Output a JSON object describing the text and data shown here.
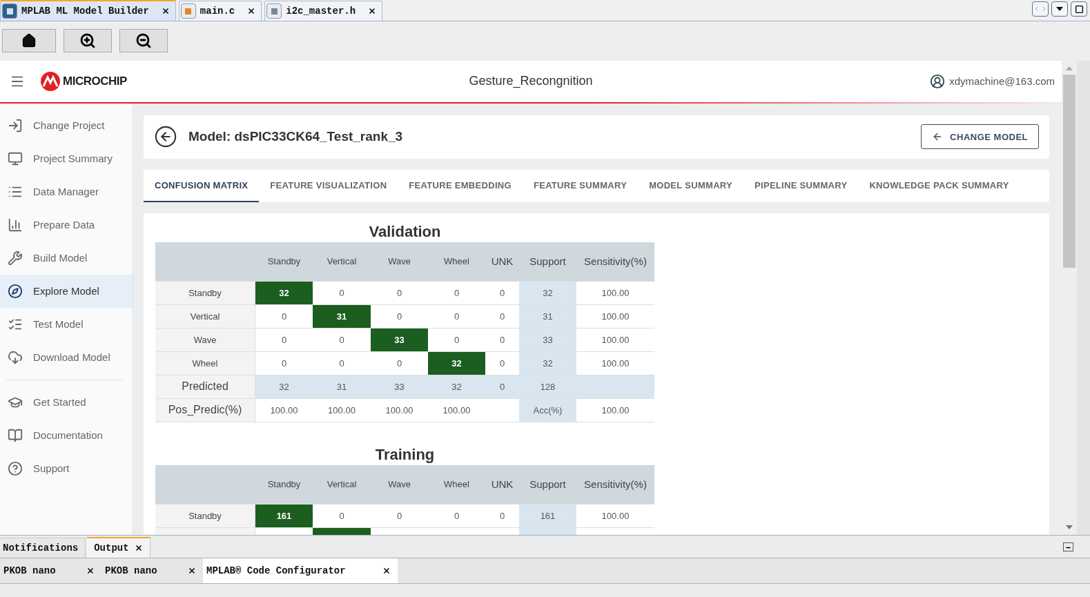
{
  "editor_tabs": [
    {
      "label": "MPLAB ML Model Builder",
      "kind": "app",
      "selected": true
    },
    {
      "label": "main.c",
      "kind": "c",
      "selected": false
    },
    {
      "label": "i2c_master.h",
      "kind": "h",
      "selected": false
    }
  ],
  "app_header": {
    "logo": "MICROCHIP",
    "project": "Gesture_Recongnition",
    "user": "xdymachine@163.com"
  },
  "sidebar": {
    "groups": [
      {
        "items": [
          {
            "label": "Change Project",
            "selected": false
          },
          {
            "label": "Project Summary",
            "selected": false
          },
          {
            "label": "Data Manager",
            "selected": false
          },
          {
            "label": "Prepare Data",
            "selected": false
          },
          {
            "label": "Build Model",
            "selected": false
          },
          {
            "label": "Explore Model",
            "selected": true
          },
          {
            "label": "Test Model",
            "selected": false
          },
          {
            "label": "Download Model",
            "selected": false
          }
        ]
      },
      {
        "items": [
          {
            "label": "Get Started",
            "selected": false
          },
          {
            "label": "Documentation",
            "selected": false
          },
          {
            "label": "Support",
            "selected": false
          }
        ]
      }
    ]
  },
  "model": {
    "title": "Model: dsPIC33CK64_Test_rank_3",
    "change_button": "CHANGE MODEL"
  },
  "tabs": [
    {
      "label": "CONFUSION MATRIX",
      "selected": true
    },
    {
      "label": "FEATURE VISUALIZATION",
      "selected": false
    },
    {
      "label": "FEATURE EMBEDDING",
      "selected": false
    },
    {
      "label": "FEATURE SUMMARY",
      "selected": false
    },
    {
      "label": "MODEL SUMMARY",
      "selected": false
    },
    {
      "label": "PIPELINE SUMMARY",
      "selected": false
    },
    {
      "label": "KNOWLEDGE PACK SUMMARY",
      "selected": false
    }
  ],
  "matrices": [
    {
      "title": "Validation",
      "columns": [
        {
          "label": "Standby",
          "kind": "class"
        },
        {
          "label": "Vertical",
          "kind": "class"
        },
        {
          "label": "Wave",
          "kind": "class"
        },
        {
          "label": "Wheel",
          "kind": "class"
        },
        {
          "label": "UNK",
          "kind": "metric"
        },
        {
          "label": "Support",
          "kind": "metric"
        },
        {
          "label": "Sensitivity(%)",
          "kind": "metric"
        }
      ],
      "rows": [
        {
          "label": "Standby",
          "kind": "class",
          "cells": [
            {
              "text": "32",
              "kind": "hit"
            },
            {
              "text": "0",
              "kind": "n"
            },
            {
              "text": "0",
              "kind": "n"
            },
            {
              "text": "0",
              "kind": "n"
            },
            {
              "text": "0",
              "kind": "n"
            },
            {
              "text": "32",
              "kind": "sup"
            },
            {
              "text": "100.00",
              "kind": "n"
            }
          ]
        },
        {
          "label": "Vertical",
          "kind": "class",
          "cells": [
            {
              "text": "0",
              "kind": "n"
            },
            {
              "text": "31",
              "kind": "hit"
            },
            {
              "text": "0",
              "kind": "n"
            },
            {
              "text": "0",
              "kind": "n"
            },
            {
              "text": "0",
              "kind": "n"
            },
            {
              "text": "31",
              "kind": "sup"
            },
            {
              "text": "100.00",
              "kind": "n"
            }
          ]
        },
        {
          "label": "Wave",
          "kind": "class",
          "cells": [
            {
              "text": "0",
              "kind": "n"
            },
            {
              "text": "0",
              "kind": "n"
            },
            {
              "text": "33",
              "kind": "hit"
            },
            {
              "text": "0",
              "kind": "n"
            },
            {
              "text": "0",
              "kind": "n"
            },
            {
              "text": "33",
              "kind": "sup"
            },
            {
              "text": "100.00",
              "kind": "n"
            }
          ]
        },
        {
          "label": "Wheel",
          "kind": "class",
          "cells": [
            {
              "text": "0",
              "kind": "n"
            },
            {
              "text": "0",
              "kind": "n"
            },
            {
              "text": "0",
              "kind": "n"
            },
            {
              "text": "32",
              "kind": "hit"
            },
            {
              "text": "0",
              "kind": "n"
            },
            {
              "text": "32",
              "kind": "sup"
            },
            {
              "text": "100.00",
              "kind": "n"
            }
          ]
        },
        {
          "label": "Predicted",
          "kind": "summary",
          "cells": [
            {
              "text": "32",
              "kind": "sup"
            },
            {
              "text": "31",
              "kind": "sup"
            },
            {
              "text": "33",
              "kind": "sup"
            },
            {
              "text": "32",
              "kind": "sup"
            },
            {
              "text": "0",
              "kind": "sup"
            },
            {
              "text": "128",
              "kind": "sup"
            },
            {
              "kind": "sup"
            }
          ]
        },
        {
          "label": "Pos_Predic(%)",
          "kind": "summary",
          "cells": [
            {
              "text": "100.00",
              "kind": "n"
            },
            {
              "text": "100.00",
              "kind": "n"
            },
            {
              "text": "100.00",
              "kind": "n"
            },
            {
              "text": "100.00",
              "kind": "n"
            },
            {
              "kind": "n"
            },
            {
              "text": "Acc(%)",
              "kind": "sup"
            },
            {
              "text": "100.00",
              "kind": "n"
            }
          ]
        }
      ]
    },
    {
      "title": "Training",
      "columns": [
        {
          "label": "Standby",
          "kind": "class"
        },
        {
          "label": "Vertical",
          "kind": "class"
        },
        {
          "label": "Wave",
          "kind": "class"
        },
        {
          "label": "Wheel",
          "kind": "class"
        },
        {
          "label": "UNK",
          "kind": "metric"
        },
        {
          "label": "Support",
          "kind": "metric"
        },
        {
          "label": "Sensitivity(%)",
          "kind": "metric"
        }
      ],
      "rows": [
        {
          "label": "Standby",
          "kind": "class",
          "cells": [
            {
              "text": "161",
              "kind": "hit"
            },
            {
              "text": "0",
              "kind": "n"
            },
            {
              "text": "0",
              "kind": "n"
            },
            {
              "text": "0",
              "kind": "n"
            },
            {
              "text": "0",
              "kind": "n"
            },
            {
              "text": "161",
              "kind": "sup"
            },
            {
              "text": "100.00",
              "kind": "n"
            }
          ]
        },
        {
          "kind": "class",
          "cells": [
            {
              "kind": "n"
            },
            {
              "kind": "hit"
            },
            {
              "kind": "n"
            },
            {
              "kind": "n"
            },
            {
              "kind": "n"
            },
            {
              "kind": "sup"
            },
            {
              "kind": "n"
            }
          ]
        }
      ]
    }
  ],
  "bottom_panel": {
    "tabs": [
      {
        "label": "Notifications",
        "selected": false,
        "closable": false
      },
      {
        "label": "Output",
        "selected": true,
        "closable": true
      }
    ],
    "doc_tabs": [
      {
        "label": "PKOB nano",
        "selected": false
      },
      {
        "label": "PKOB nano",
        "selected": false
      },
      {
        "label": "MPLAB® Code Configurator",
        "selected": true
      }
    ]
  }
}
